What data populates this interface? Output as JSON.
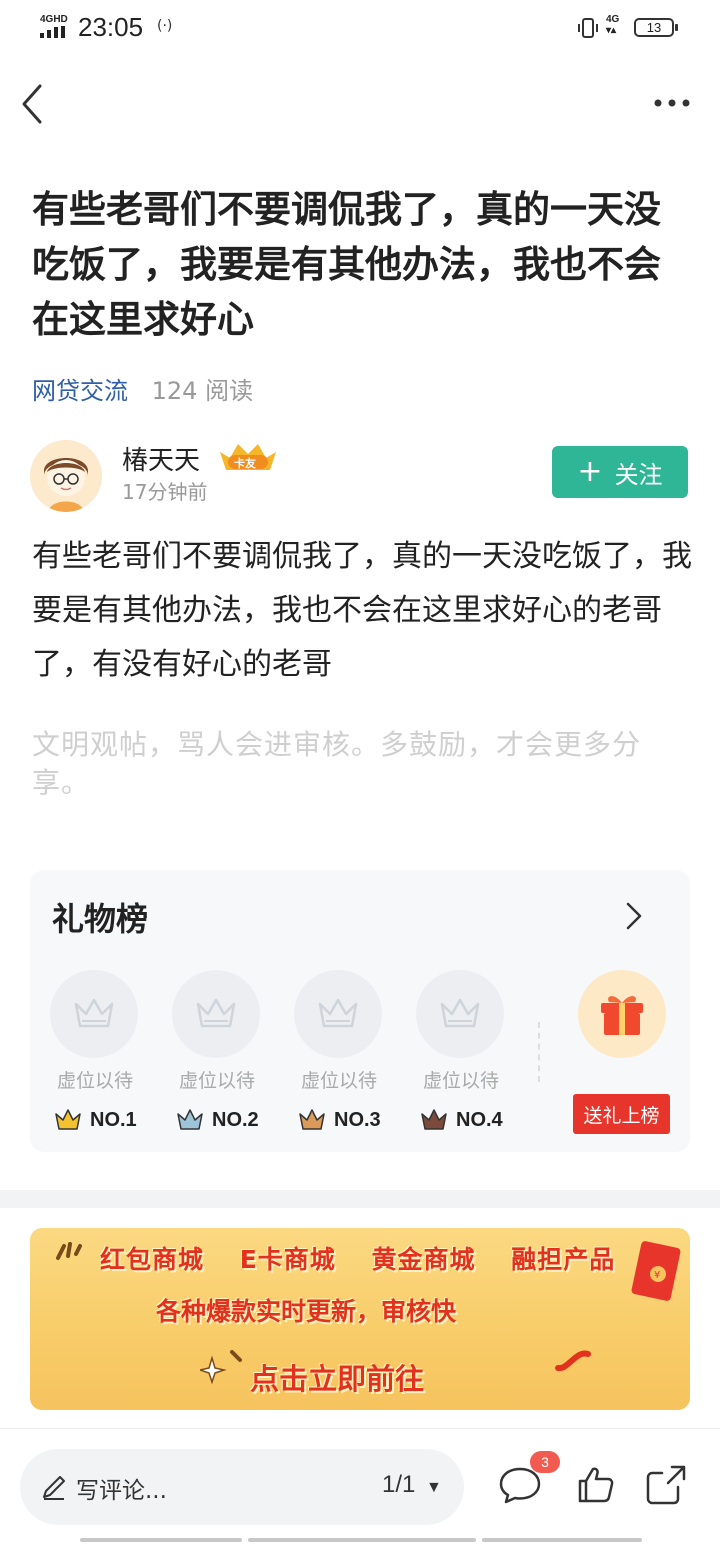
{
  "status_bar": {
    "network": "4GHD",
    "time": "23:05",
    "network_right": "4G",
    "battery": "13"
  },
  "post": {
    "title": "有些老哥们不要调侃我了，真的一天没吃饭了，我要是有其他办法，我也不会在这里求好心",
    "category": "网贷交流",
    "reads": "124 阅读",
    "author": {
      "name": "椿天天",
      "badge": "卡友",
      "time": "17分钟前"
    },
    "follow_label": "关注",
    "body": "有些老哥们不要调侃我了，真的一天没吃饭了，我要是有其他办法，我也不会在这里求好心的老哥了，有没有好心的老哥",
    "notice": "文明观帖，骂人会进审核。多鼓励，才会更多分享。"
  },
  "gifts": {
    "title": "礼物榜",
    "slots": [
      {
        "label": "虚位以待",
        "rank": "NO.1",
        "crown_color": "#f2c230"
      },
      {
        "label": "虚位以待",
        "rank": "NO.2",
        "crown_color": "#9ec4d9"
      },
      {
        "label": "虚位以待",
        "rank": "NO.3",
        "crown_color": "#d99a5a"
      },
      {
        "label": "虚位以待",
        "rank": "NO.4",
        "crown_color": "#7b4a3a"
      }
    ],
    "send_label": "送礼上榜"
  },
  "banner": {
    "row1": "红包商城 E卡商城 黄金商城 融担产品",
    "row2": "各种爆款实时更新，审核快",
    "row3": "点击立即前往"
  },
  "bottom": {
    "comment_placeholder": "写评论...",
    "pager": "1/1",
    "comment_count": "3"
  },
  "colors": {
    "accent": "#2fb696",
    "link": "#2f5fa8",
    "danger": "#e8352b"
  }
}
